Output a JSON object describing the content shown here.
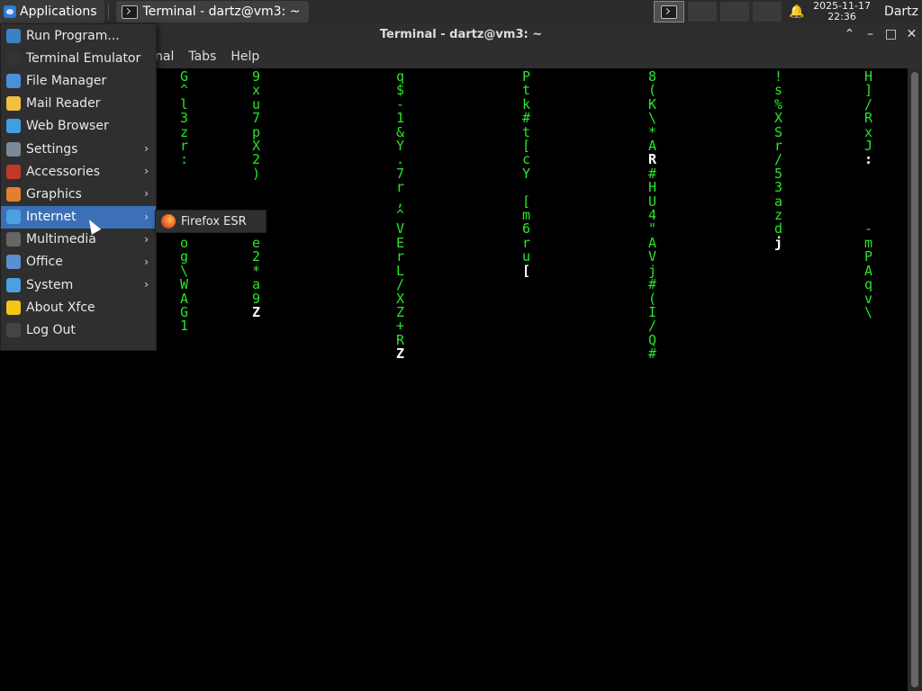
{
  "panel": {
    "apps_label": "Applications",
    "task_label": "Terminal - dartz@vm3: ~",
    "date": "2025-11-17",
    "time": "22:36",
    "user": "Dartz"
  },
  "window": {
    "title": "Terminal - dartz@vm3: ~",
    "menubar": [
      "nal",
      "Tabs",
      "Help"
    ]
  },
  "apps_menu": {
    "items": [
      {
        "label": "Run Program...",
        "icon": "run-icon",
        "color": "#3b82c4"
      },
      {
        "label": "Terminal Emulator",
        "icon": "terminal-icon",
        "color": "#333333"
      },
      {
        "label": "File Manager",
        "icon": "folder-icon",
        "color": "#4a90d9"
      },
      {
        "label": "Mail Reader",
        "icon": "mail-icon",
        "color": "#f0c040"
      },
      {
        "label": "Web Browser",
        "icon": "globe-icon",
        "color": "#3fa0e0"
      },
      {
        "label": "Settings",
        "icon": "settings-icon",
        "color": "#7a8a9a",
        "submenu": true
      },
      {
        "label": "Accessories",
        "icon": "accessories-icon",
        "color": "#c0392b",
        "submenu": true
      },
      {
        "label": "Graphics",
        "icon": "graphics-icon",
        "color": "#e08030",
        "submenu": true
      },
      {
        "label": "Internet",
        "icon": "internet-icon",
        "color": "#4aa0e0",
        "submenu": true,
        "highlighted": true
      },
      {
        "label": "Multimedia",
        "icon": "multimedia-icon",
        "color": "#666666",
        "submenu": true
      },
      {
        "label": "Office",
        "icon": "office-icon",
        "color": "#5a8fd0",
        "submenu": true
      },
      {
        "label": "System",
        "icon": "system-icon",
        "color": "#4aa0e0",
        "submenu": true
      },
      {
        "label": "About Xfce",
        "icon": "star-icon",
        "color": "#f5c518"
      },
      {
        "label": "Log Out",
        "icon": "logout-icon",
        "color": "#444444"
      }
    ],
    "submenu_item": {
      "label": "Firefox ESR",
      "icon": "firefox-icon"
    }
  },
  "colors": {
    "rain": "#27e827",
    "accent": "#3b6fb6"
  }
}
